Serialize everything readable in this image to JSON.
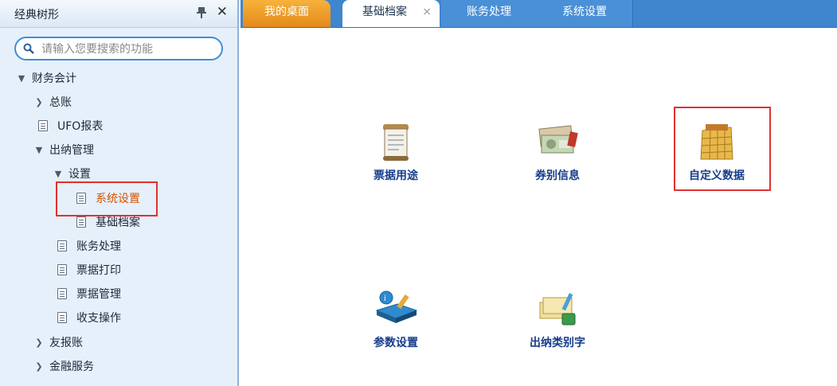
{
  "sidebar": {
    "title": "经典树形",
    "search_placeholder": "请输入您要搜索的功能",
    "items": [
      {
        "label": "财务会计",
        "expander": "down"
      },
      {
        "label": "总账",
        "expander": "right"
      },
      {
        "label": "UFO报表",
        "icon": "document-icon"
      },
      {
        "label": "出纳管理",
        "expander": "down"
      },
      {
        "label": "设置",
        "expander": "down"
      },
      {
        "label": "系统设置",
        "icon": "document-icon",
        "selected": true
      },
      {
        "label": "基础档案",
        "icon": "document-icon"
      },
      {
        "label": "账务处理",
        "icon": "document-icon"
      },
      {
        "label": "票据打印",
        "icon": "document-icon"
      },
      {
        "label": "票据管理",
        "icon": "document-icon"
      },
      {
        "label": "收支操作",
        "icon": "document-icon"
      },
      {
        "label": "友报账",
        "expander": "right"
      },
      {
        "label": "金融服务",
        "expander": "right"
      }
    ]
  },
  "tabs": [
    {
      "label": "我的桌面"
    },
    {
      "label": "基础档案",
      "active": true,
      "close": "×"
    },
    {
      "label": "账务处理"
    },
    {
      "label": "系统设置"
    }
  ],
  "tiles": [
    {
      "label": "票据用途",
      "icon": "receipt-scroll-icon"
    },
    {
      "label": "券别信息",
      "icon": "currency-notes-icon"
    },
    {
      "label": "自定义数据",
      "icon": "calendar-grid-icon",
      "highlighted": true
    },
    {
      "label": "参数设置",
      "icon": "book-settings-icon"
    },
    {
      "label": "出纳类别字",
      "icon": "cashier-category-icon"
    }
  ],
  "colors": {
    "accent": "#3f86cf",
    "home_tab": "#e3891a",
    "highlight": "#e03131",
    "tile_label": "#163d8a",
    "selected_text": "#d35400"
  }
}
